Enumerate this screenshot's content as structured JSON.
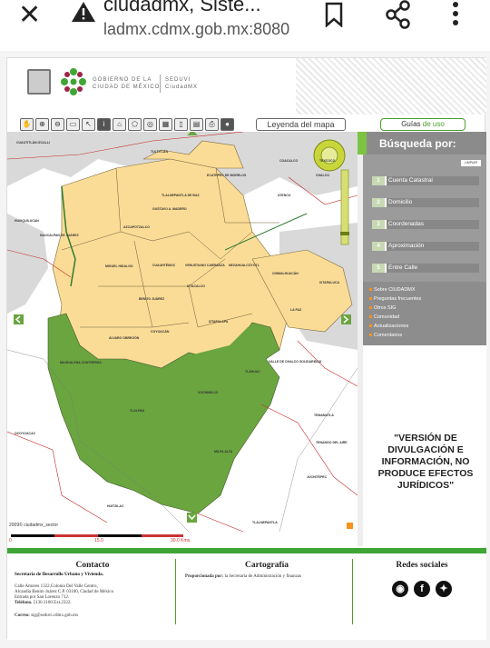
{
  "browser": {
    "page_title": "ciudadmx, Siste...",
    "url_host": "ladmx.cdmx.gob.mx",
    "url_port": ":8080"
  },
  "header": {
    "gov_line1": "GOBIERNO DE LA",
    "gov_line2": "CIUDAD DE MÉXICO",
    "seduvi_line1": "SEDUVI",
    "seduvi_line2": "CiudadMX"
  },
  "toolbar": {
    "legend_label": "Leyenda del mapa",
    "guides_label_1": "Guías ",
    "guides_label_2": "de uso"
  },
  "map": {
    "copyright": "2009© ciudadmx_sector",
    "scale_mid": "15.0",
    "scale_end": "30.0 Kms.",
    "scale_start": "0",
    "labels": [
      {
        "t": "NAUCALPAN DE JUÁREZ"
      },
      {
        "t": "AZCAPOTZALCO"
      },
      {
        "t": "GUSTAVO A. MADERO"
      },
      {
        "t": "TLALNEPANTLA DE BAZ"
      },
      {
        "t": "MIGUEL HIDALGO"
      },
      {
        "t": "CUAUHTÉMOC"
      },
      {
        "t": "VENUSTIANO CARRANZA"
      },
      {
        "t": "NEZAHUALCÓYOTL"
      },
      {
        "t": "IZTACALCO"
      },
      {
        "t": "BENITO JUÁREZ"
      },
      {
        "t": "COYOACÁN"
      },
      {
        "t": "IZTAPALAPA"
      },
      {
        "t": "ÁLVARO OBREGÓN"
      },
      {
        "t": "MAGDALENA CONTRERAS"
      },
      {
        "t": "TLALPAN"
      },
      {
        "t": "XOCHIMILCO"
      },
      {
        "t": "TLÁHUAC"
      },
      {
        "t": "MILPA ALTA"
      },
      {
        "t": "CHALCO"
      },
      {
        "t": "VALLE DE CHALCO SOLIDARIDAD"
      },
      {
        "t": "LA PAZ"
      },
      {
        "t": "CHIMALHUACÁN"
      },
      {
        "t": "ECATEPEC DE MORELOS"
      },
      {
        "t": "HUIXQUILUCAN"
      },
      {
        "t": "TEMAMATLA"
      },
      {
        "t": "TENANGO DEL AIRE"
      },
      {
        "t": "JUCHITEPEC"
      },
      {
        "t": "HUITZILAC"
      },
      {
        "t": "TLALNEPANTLA"
      },
      {
        "t": "OCOYOACAC"
      },
      {
        "t": "ATENCO"
      },
      {
        "t": "TEXCOCO"
      },
      {
        "t": "IXTAPALUCA"
      },
      {
        "t": "TULTITLÁN"
      },
      {
        "t": "COACALCO"
      },
      {
        "t": "CUAUTITLÁN IZCALLI"
      }
    ]
  },
  "sidebar": {
    "title": "Búsqueda por:",
    "clear_label": "LIMPIAR",
    "options": [
      {
        "num": "1",
        "label": "Cuenta Catastral"
      },
      {
        "num": "2",
        "label": "Domicilio"
      },
      {
        "num": "3",
        "label": "Coordenadas"
      },
      {
        "num": "4",
        "label": "Aproximación"
      },
      {
        "num": "5",
        "label": "Entre Calle"
      }
    ],
    "links": [
      {
        "label": "Sobre CIUDADMX"
      },
      {
        "label": "Preguntas frecuentes"
      },
      {
        "label": "Otros SIG"
      },
      {
        "label": "Comunidad"
      },
      {
        "label": "Actualizaciones"
      },
      {
        "label": "Comentarios"
      }
    ],
    "notice": "\"VERSIÓN DE DIVULGACIÓN E INFORMACIÓN, NO PRODUCE EFECTOS JURÍDICOS\""
  },
  "footer": {
    "contact_title": "Contacto",
    "contact_org": "Secretaría de Desarrollo Urbano y Vivienda.",
    "contact_addr1": "Calle Amores 1322,Colonia Del Valle Centro,",
    "contact_addr2": "Alcandía Benito Juárez C.P. 03100, Ciudad de México",
    "contact_addr3": "Entrada por San Lorenzo 712.",
    "contact_phone_label": "Teléfono.",
    "contact_phone": " 5130 2100 Ext.2322.",
    "contact_email_label": "Correo:",
    "contact_email": " sig@seduvi.cdmx.gob.mx",
    "carto_title": "Cartografía",
    "carto_label": "Proporcionada por:",
    "carto_text": " la Secretaría de Administración y finanzas",
    "social_title": "Redes sociales"
  }
}
